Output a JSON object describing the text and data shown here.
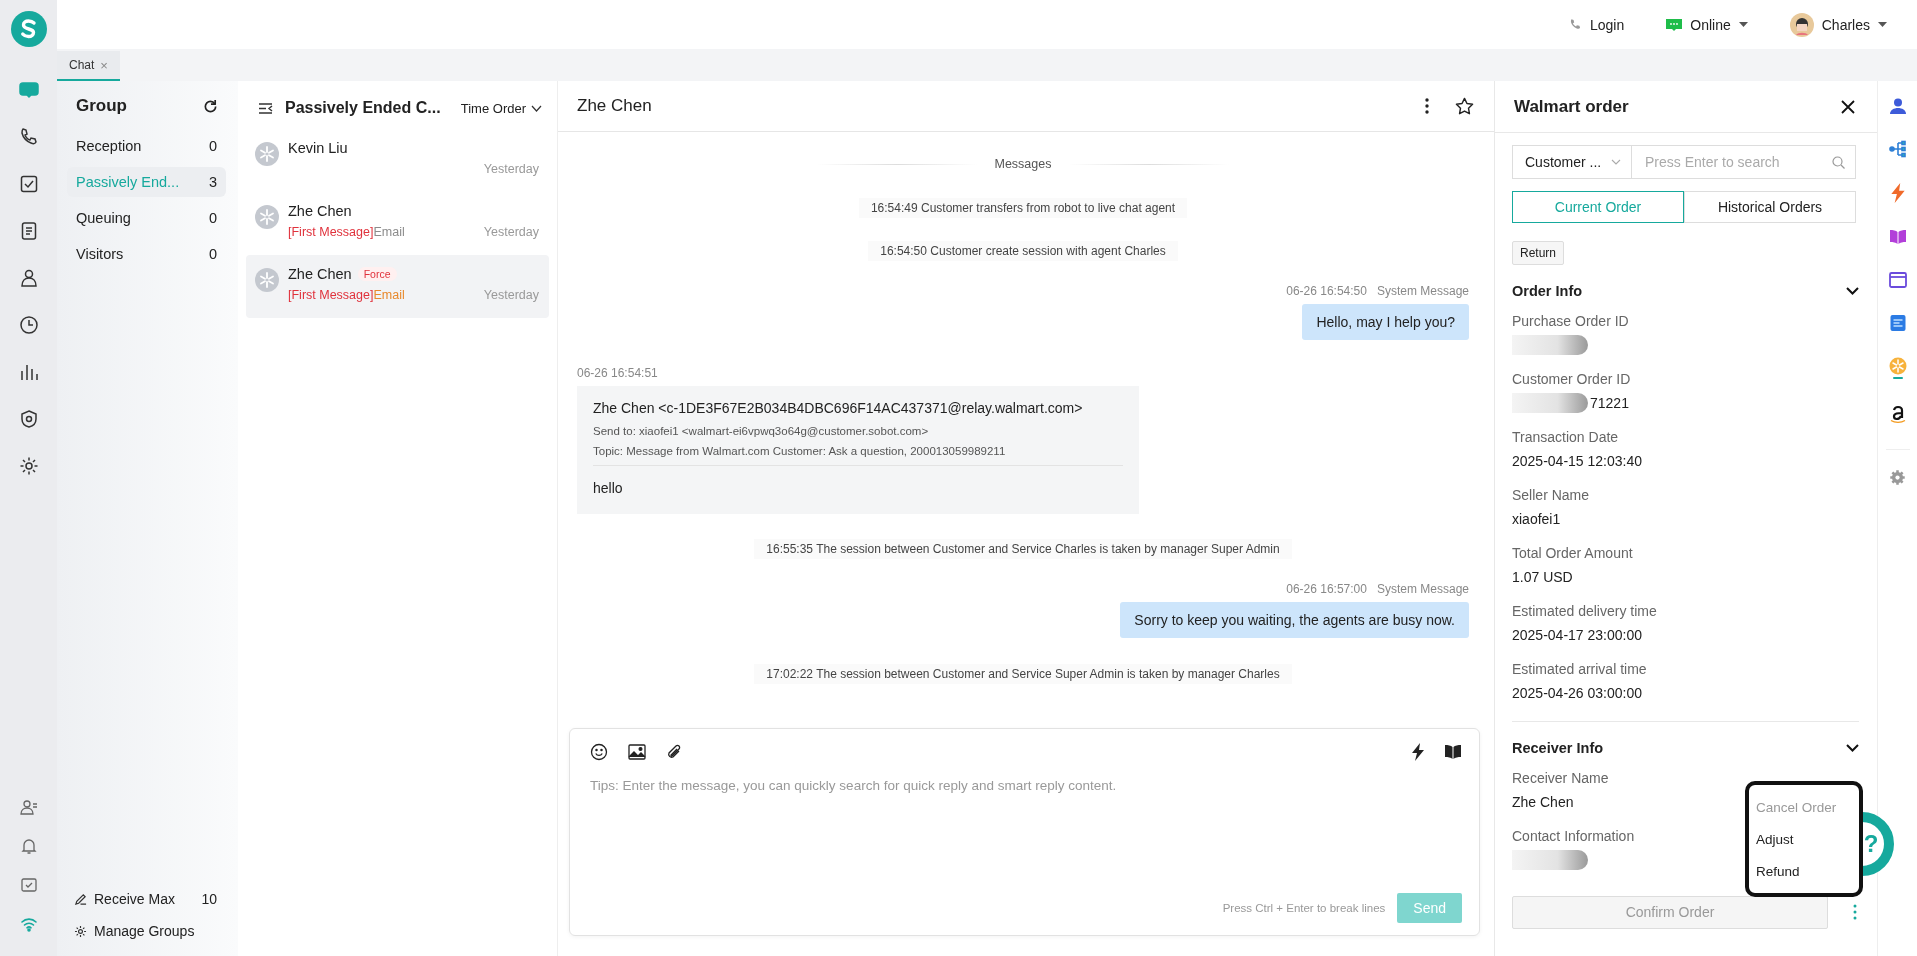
{
  "header": {
    "login": "Login",
    "status": "Online",
    "user": "Charles"
  },
  "tabs": [
    {
      "label": "Chat",
      "close": "×",
      "selected": true
    }
  ],
  "nav": [
    {
      "selected": true
    },
    {
      "selected": false
    },
    {
      "selected": false
    },
    {
      "selected": false
    },
    {
      "selected": false
    },
    {
      "selected": false
    },
    {
      "selected": false
    },
    {
      "selected": false
    },
    {
      "selected": false
    }
  ],
  "groups": {
    "title": "Group",
    "items": [
      {
        "label": "Reception",
        "count": "0",
        "selected": false
      },
      {
        "label": "Passively End...",
        "count": "3",
        "selected": true
      },
      {
        "label": "Queuing",
        "count": "0",
        "selected": false
      },
      {
        "label": "Visitors",
        "count": "0",
        "selected": false
      }
    ],
    "receive_max": {
      "label": "Receive Max",
      "value": "10"
    },
    "manage": "Manage Groups"
  },
  "conversations": {
    "title": "Passively Ended C...",
    "sort": "Time Order",
    "items": [
      {
        "name": "Kevin Liu",
        "time": "Yesterday",
        "selected": false
      },
      {
        "name": "Zhe Chen",
        "tag": "[First Message]",
        "preview": "Email",
        "color": "#8c8c8c",
        "time": "Yesterday",
        "selected": false
      },
      {
        "name": "Zhe Chen",
        "badge": "Force",
        "tag": "[First Message]",
        "preview": "Email",
        "color": "#e8892c",
        "time": "Yesterday",
        "selected": true
      }
    ]
  },
  "chat": {
    "title": "Zhe Chen",
    "messages": [
      {
        "kind": "divider",
        "text": "Messages"
      },
      {
        "kind": "system",
        "text": "16:54:49 Customer transfers from robot to live chat agent"
      },
      {
        "kind": "system",
        "text": "16:54:50 Customer create session with agent Charles"
      },
      {
        "kind": "outgoing",
        "time": "06-26 16:54:50",
        "sender": "System Message",
        "text": "Hello, may I help you?"
      },
      {
        "kind": "email",
        "time": "06-26 16:54:51",
        "from": "Zhe Chen <c-1DE3F67E2B034B4DBC696F14AC437371@relay.walmart.com>",
        "send_to": "Send to: xiaofei1 <walmart-ei6vpwq3o64g@customer.sobot.com>",
        "topic": "Topic: Message from Walmart.com Customer:  Ask a question, 200013059989211",
        "body": "hello"
      },
      {
        "kind": "system",
        "text": "16:55:35 The session between Customer and Service Charles is taken by manager Super Admin"
      },
      {
        "kind": "outgoing",
        "time": "06-26 16:57:00",
        "sender": "System Message",
        "text": "Sorry to keep you waiting, the agents are busy now."
      },
      {
        "kind": "system",
        "text": "17:02:22 The session between Customer and Service Super Admin is taken by manager Charles"
      }
    ],
    "composer": {
      "placeholder": "Tips: Enter the message, you can quickly search for quick reply and smart reply content.",
      "hint": "Press Ctrl + Enter to break lines",
      "send": "Send",
      "send_disabled": true
    }
  },
  "order": {
    "title": "Walmart order",
    "search_type": "Customer ...",
    "search_placeholder": "Press Enter to search",
    "tabs": [
      {
        "label": "Current Order",
        "selected": true
      },
      {
        "label": "Historical Orders",
        "selected": false
      }
    ],
    "return": "Return",
    "sections": [
      {
        "title": "Order Info",
        "expanded": true,
        "fields": [
          {
            "label": "Purchase Order ID",
            "redacted": true
          },
          {
            "label": "Customer Order ID",
            "value": "71221",
            "redacted": true
          },
          {
            "label": "Transaction Date",
            "value": "2025-04-15 12:03:40",
            "redacted": false
          },
          {
            "label": "Seller Name",
            "value": "xiaofei1",
            "redacted": false
          },
          {
            "label": "Total Order Amount",
            "value": "1.07 USD",
            "redacted": false
          },
          {
            "label": "Estimated delivery time",
            "value": "2025-04-17 23:00:00",
            "redacted": false
          },
          {
            "label": "Estimated arrival time",
            "value": "2025-04-26 03:00:00",
            "redacted": false
          }
        ]
      },
      {
        "title": "Receiver Info",
        "expanded": true,
        "fields": [
          {
            "label": "Receiver Name",
            "value": "Zhe Chen",
            "redacted": false
          },
          {
            "label": "Contact Information",
            "redacted": true
          }
        ]
      }
    ],
    "confirm": "Confirm Order",
    "confirm_disabled": true,
    "menu": [
      {
        "label": "Cancel Order",
        "disabled": true
      },
      {
        "label": "Adjust",
        "disabled": false
      },
      {
        "label": "Refund",
        "disabled": false
      }
    ],
    "help": "?"
  }
}
